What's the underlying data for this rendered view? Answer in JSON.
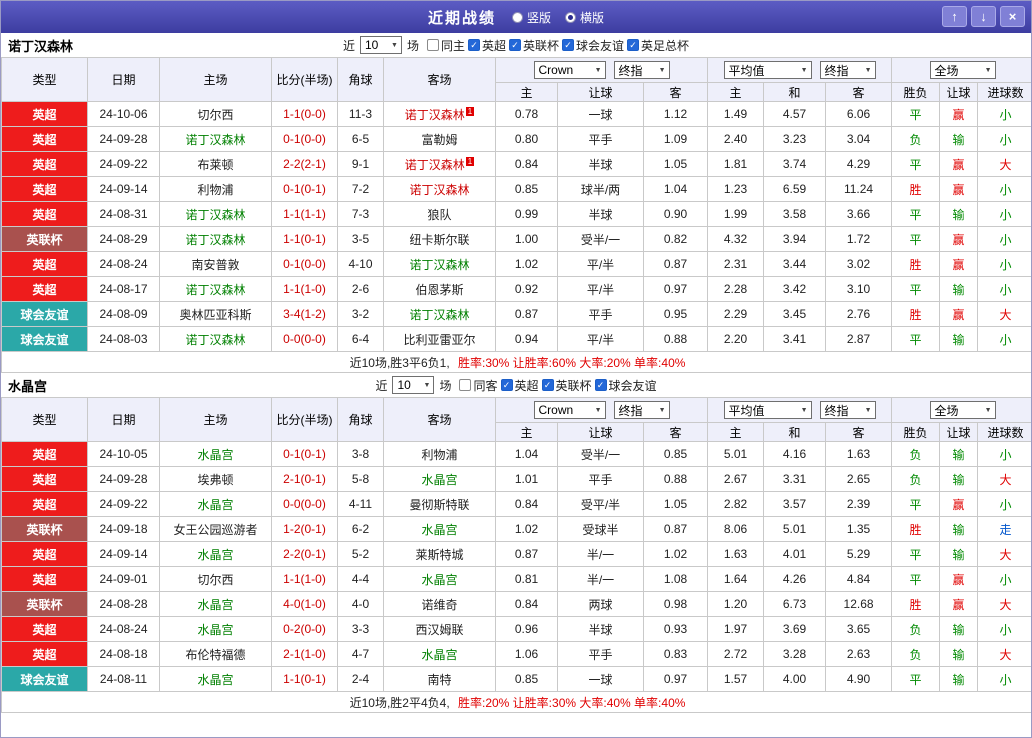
{
  "titlebar": {
    "title": "近期战绩",
    "layout_options": [
      {
        "label": "竖版",
        "selected": false
      },
      {
        "label": "横版",
        "selected": true
      }
    ],
    "buttons": {
      "up": "↑",
      "down": "↓",
      "close": "×"
    }
  },
  "palette": {
    "red": "#e00000",
    "green": "#008a00",
    "blue": "#0055cc",
    "teamGreen": "#008000",
    "teamRed": "#cc0000",
    "black": "#222222",
    "score": "#cc0000",
    "eplBg": "#ee1c1c",
    "eflBg": "#a9514e",
    "friendlyBg": "#2ba8a8"
  },
  "sections": [
    {
      "team": "诺丁汉森林",
      "filter": {
        "prefix": "近",
        "count": "10",
        "suffix": "场",
        "checkboxes": [
          {
            "label": "同主",
            "checked": false
          },
          {
            "label": "英超",
            "checked": true
          },
          {
            "label": "英联杯",
            "checked": true
          },
          {
            "label": "球会友谊",
            "checked": true
          },
          {
            "label": "英足总杯",
            "checked": true
          }
        ]
      },
      "header": {
        "type": "类型",
        "date": "日期",
        "home": "主场",
        "score": "比分(半场)",
        "corners": "角球",
        "away": "客场",
        "ah_group": {
          "bookmaker": "Crown",
          "final": "终指",
          "cols": [
            "主",
            "让球",
            "客"
          ]
        },
        "avg_group": {
          "avg": "平均值",
          "final": "终指",
          "cols": [
            "主",
            "和",
            "客"
          ]
        },
        "ft_group": {
          "fulltime": "全场",
          "cols": [
            "胜负",
            "让球",
            "进球数"
          ]
        }
      },
      "rows": [
        {
          "type": "英超",
          "type_bg": "eplBg",
          "date": "24-10-06",
          "home": "切尔西",
          "home_color": "black",
          "home_badge": "",
          "score": "1-1(0-0)",
          "corners": "11-3",
          "away": "诺丁汉森林",
          "away_color": "teamRed",
          "away_badge": "1",
          "ah_home": "0.78",
          "ah_line": "一球",
          "ah_away": "1.12",
          "avg_home": "1.49",
          "avg_draw": "4.57",
          "avg_away": "6.06",
          "result": "平",
          "result_color": "green",
          "handicap": "赢",
          "handicap_color": "red",
          "goals": "小",
          "goals_color": "green"
        },
        {
          "type": "英超",
          "type_bg": "eplBg",
          "date": "24-09-28",
          "home": "诺丁汉森林",
          "home_color": "teamGreen",
          "home_badge": "",
          "score": "0-1(0-0)",
          "corners": "6-5",
          "away": "富勒姆",
          "away_color": "black",
          "away_badge": "",
          "ah_home": "0.80",
          "ah_line": "平手",
          "ah_away": "1.09",
          "avg_home": "2.40",
          "avg_draw": "3.23",
          "avg_away": "3.04",
          "result": "负",
          "result_color": "green",
          "handicap": "输",
          "handicap_color": "green",
          "goals": "小",
          "goals_color": "green"
        },
        {
          "type": "英超",
          "type_bg": "eplBg",
          "date": "24-09-22",
          "home": "布莱顿",
          "home_color": "black",
          "home_badge": "",
          "score": "2-2(2-1)",
          "corners": "9-1",
          "away": "诺丁汉森林",
          "away_color": "teamRed",
          "away_badge": "1",
          "ah_home": "0.84",
          "ah_line": "半球",
          "ah_away": "1.05",
          "avg_home": "1.81",
          "avg_draw": "3.74",
          "avg_away": "4.29",
          "result": "平",
          "result_color": "green",
          "handicap": "赢",
          "handicap_color": "red",
          "goals": "大",
          "goals_color": "red"
        },
        {
          "type": "英超",
          "type_bg": "eplBg",
          "date": "24-09-14",
          "home": "利物浦",
          "home_color": "black",
          "home_badge": "",
          "score": "0-1(0-1)",
          "corners": "7-2",
          "away": "诺丁汉森林",
          "away_color": "teamRed",
          "away_badge": "",
          "ah_home": "0.85",
          "ah_line": "球半/两",
          "ah_away": "1.04",
          "avg_home": "1.23",
          "avg_draw": "6.59",
          "avg_away": "11.24",
          "result": "胜",
          "result_color": "red",
          "handicap": "赢",
          "handicap_color": "red",
          "goals": "小",
          "goals_color": "green"
        },
        {
          "type": "英超",
          "type_bg": "eplBg",
          "date": "24-08-31",
          "home": "诺丁汉森林",
          "home_color": "teamGreen",
          "home_badge": "",
          "score": "1-1(1-1)",
          "corners": "7-3",
          "away": "狼队",
          "away_color": "black",
          "away_badge": "",
          "ah_home": "0.99",
          "ah_line": "半球",
          "ah_away": "0.90",
          "avg_home": "1.99",
          "avg_draw": "3.58",
          "avg_away": "3.66",
          "result": "平",
          "result_color": "green",
          "handicap": "输",
          "handicap_color": "green",
          "goals": "小",
          "goals_color": "green"
        },
        {
          "type": "英联杯",
          "type_bg": "eflBg",
          "date": "24-08-29",
          "home": "诺丁汉森林",
          "home_color": "teamGreen",
          "home_badge": "",
          "score": "1-1(0-1)",
          "corners": "3-5",
          "away": "纽卡斯尔联",
          "away_color": "black",
          "away_badge": "",
          "ah_home": "1.00",
          "ah_line": "受半/一",
          "ah_away": "0.82",
          "avg_home": "4.32",
          "avg_draw": "3.94",
          "avg_away": "1.72",
          "result": "平",
          "result_color": "green",
          "handicap": "赢",
          "handicap_color": "red",
          "goals": "小",
          "goals_color": "green"
        },
        {
          "type": "英超",
          "type_bg": "eplBg",
          "date": "24-08-24",
          "home": "南安普敦",
          "home_color": "black",
          "home_badge": "",
          "score": "0-1(0-0)",
          "corners": "4-10",
          "away": "诺丁汉森林",
          "away_color": "teamGreen",
          "away_badge": "",
          "ah_home": "1.02",
          "ah_line": "平/半",
          "ah_away": "0.87",
          "avg_home": "2.31",
          "avg_draw": "3.44",
          "avg_away": "3.02",
          "result": "胜",
          "result_color": "red",
          "handicap": "赢",
          "handicap_color": "red",
          "goals": "小",
          "goals_color": "green"
        },
        {
          "type": "英超",
          "type_bg": "eplBg",
          "date": "24-08-17",
          "home": "诺丁汉森林",
          "home_color": "teamGreen",
          "home_badge": "",
          "score": "1-1(1-0)",
          "corners": "2-6",
          "away": "伯恩茅斯",
          "away_color": "black",
          "away_badge": "",
          "ah_home": "0.92",
          "ah_line": "平/半",
          "ah_away": "0.97",
          "avg_home": "2.28",
          "avg_draw": "3.42",
          "avg_away": "3.10",
          "result": "平",
          "result_color": "green",
          "handicap": "输",
          "handicap_color": "green",
          "goals": "小",
          "goals_color": "green"
        },
        {
          "type": "球会友谊",
          "type_bg": "friendlyBg",
          "date": "24-08-09",
          "home": "奥林匹亚科斯",
          "home_color": "black",
          "home_badge": "",
          "score": "3-4(1-2)",
          "corners": "3-2",
          "away": "诺丁汉森林",
          "away_color": "teamGreen",
          "away_badge": "",
          "ah_home": "0.87",
          "ah_line": "平手",
          "ah_away": "0.95",
          "avg_home": "2.29",
          "avg_draw": "3.45",
          "avg_away": "2.76",
          "result": "胜",
          "result_color": "red",
          "handicap": "赢",
          "handicap_color": "red",
          "goals": "大",
          "goals_color": "red"
        },
        {
          "type": "球会友谊",
          "type_bg": "friendlyBg",
          "date": "24-08-03",
          "home": "诺丁汉森林",
          "home_color": "teamGreen",
          "home_badge": "",
          "score": "0-0(0-0)",
          "corners": "6-4",
          "away": "比利亚雷亚尔",
          "away_color": "black",
          "away_badge": "",
          "ah_home": "0.94",
          "ah_line": "平/半",
          "ah_away": "0.88",
          "avg_home": "2.20",
          "avg_draw": "3.41",
          "avg_away": "2.87",
          "result": "平",
          "result_color": "green",
          "handicap": "输",
          "handicap_color": "green",
          "goals": "小",
          "goals_color": "green"
        }
      ],
      "summary": {
        "record": "近10场,胜3平6负1,",
        "rates": "胜率:30% 让胜率:60% 大率:20% 单率:40%"
      }
    },
    {
      "team": "水晶宫",
      "filter": {
        "prefix": "近",
        "count": "10",
        "suffix": "场",
        "checkboxes": [
          {
            "label": "同客",
            "checked": false
          },
          {
            "label": "英超",
            "checked": true
          },
          {
            "label": "英联杯",
            "checked": true
          },
          {
            "label": "球会友谊",
            "checked": true
          }
        ]
      },
      "header": {
        "type": "类型",
        "date": "日期",
        "home": "主场",
        "score": "比分(半场)",
        "corners": "角球",
        "away": "客场",
        "ah_group": {
          "bookmaker": "Crown",
          "final": "终指",
          "cols": [
            "主",
            "让球",
            "客"
          ]
        },
        "avg_group": {
          "avg": "平均值",
          "final": "终指",
          "cols": [
            "主",
            "和",
            "客"
          ]
        },
        "ft_group": {
          "fulltime": "全场",
          "cols": [
            "胜负",
            "让球",
            "进球数"
          ]
        }
      },
      "rows": [
        {
          "type": "英超",
          "type_bg": "eplBg",
          "date": "24-10-05",
          "home": "水晶宫",
          "home_color": "teamGreen",
          "home_badge": "",
          "score": "0-1(0-1)",
          "corners": "3-8",
          "away": "利物浦",
          "away_color": "black",
          "away_badge": "",
          "ah_home": "1.04",
          "ah_line": "受半/一",
          "ah_away": "0.85",
          "avg_home": "5.01",
          "avg_draw": "4.16",
          "avg_away": "1.63",
          "result": "负",
          "result_color": "green",
          "handicap": "输",
          "handicap_color": "green",
          "goals": "小",
          "goals_color": "green"
        },
        {
          "type": "英超",
          "type_bg": "eplBg",
          "date": "24-09-28",
          "home": "埃弗顿",
          "home_color": "black",
          "home_badge": "",
          "score": "2-1(0-1)",
          "corners": "5-8",
          "away": "水晶宫",
          "away_color": "teamGreen",
          "away_badge": "",
          "ah_home": "1.01",
          "ah_line": "平手",
          "ah_away": "0.88",
          "avg_home": "2.67",
          "avg_draw": "3.31",
          "avg_away": "2.65",
          "result": "负",
          "result_color": "green",
          "handicap": "输",
          "handicap_color": "green",
          "goals": "大",
          "goals_color": "red"
        },
        {
          "type": "英超",
          "type_bg": "eplBg",
          "date": "24-09-22",
          "home": "水晶宫",
          "home_color": "teamGreen",
          "home_badge": "",
          "score": "0-0(0-0)",
          "corners": "4-11",
          "away": "曼彻斯特联",
          "away_color": "black",
          "away_badge": "",
          "ah_home": "0.84",
          "ah_line": "受平/半",
          "ah_away": "1.05",
          "avg_home": "2.82",
          "avg_draw": "3.57",
          "avg_away": "2.39",
          "result": "平",
          "result_color": "green",
          "handicap": "赢",
          "handicap_color": "red",
          "goals": "小",
          "goals_color": "green"
        },
        {
          "type": "英联杯",
          "type_bg": "eflBg",
          "date": "24-09-18",
          "home": "女王公园巡游者",
          "home_color": "black",
          "home_badge": "",
          "score": "1-2(0-1)",
          "corners": "6-2",
          "away": "水晶宫",
          "away_color": "teamGreen",
          "away_badge": "",
          "ah_home": "1.02",
          "ah_line": "受球半",
          "ah_away": "0.87",
          "avg_home": "8.06",
          "avg_draw": "5.01",
          "avg_away": "1.35",
          "result": "胜",
          "result_color": "red",
          "handicap": "输",
          "handicap_color": "green",
          "goals": "走",
          "goals_color": "blue"
        },
        {
          "type": "英超",
          "type_bg": "eplBg",
          "date": "24-09-14",
          "home": "水晶宫",
          "home_color": "teamGreen",
          "home_badge": "",
          "score": "2-2(0-1)",
          "corners": "5-2",
          "away": "莱斯特城",
          "away_color": "black",
          "away_badge": "",
          "ah_home": "0.87",
          "ah_line": "半/一",
          "ah_away": "1.02",
          "avg_home": "1.63",
          "avg_draw": "4.01",
          "avg_away": "5.29",
          "result": "平",
          "result_color": "green",
          "handicap": "输",
          "handicap_color": "green",
          "goals": "大",
          "goals_color": "red"
        },
        {
          "type": "英超",
          "type_bg": "eplBg",
          "date": "24-09-01",
          "home": "切尔西",
          "home_color": "black",
          "home_badge": "",
          "score": "1-1(1-0)",
          "corners": "4-4",
          "away": "水晶宫",
          "away_color": "teamGreen",
          "away_badge": "",
          "ah_home": "0.81",
          "ah_line": "半/一",
          "ah_away": "1.08",
          "avg_home": "1.64",
          "avg_draw": "4.26",
          "avg_away": "4.84",
          "result": "平",
          "result_color": "green",
          "handicap": "赢",
          "handicap_color": "red",
          "goals": "小",
          "goals_color": "green"
        },
        {
          "type": "英联杯",
          "type_bg": "eflBg",
          "date": "24-08-28",
          "home": "水晶宫",
          "home_color": "teamGreen",
          "home_badge": "",
          "score": "4-0(1-0)",
          "corners": "4-0",
          "away": "诺维奇",
          "away_color": "black",
          "away_badge": "",
          "ah_home": "0.84",
          "ah_line": "两球",
          "ah_away": "0.98",
          "avg_home": "1.20",
          "avg_draw": "6.73",
          "avg_away": "12.68",
          "result": "胜",
          "result_color": "red",
          "handicap": "赢",
          "handicap_color": "red",
          "goals": "大",
          "goals_color": "red"
        },
        {
          "type": "英超",
          "type_bg": "eplBg",
          "date": "24-08-24",
          "home": "水晶宫",
          "home_color": "teamGreen",
          "home_badge": "",
          "score": "0-2(0-0)",
          "corners": "3-3",
          "away": "西汉姆联",
          "away_color": "black",
          "away_badge": "",
          "ah_home": "0.96",
          "ah_line": "半球",
          "ah_away": "0.93",
          "avg_home": "1.97",
          "avg_draw": "3.69",
          "avg_away": "3.65",
          "result": "负",
          "result_color": "green",
          "handicap": "输",
          "handicap_color": "green",
          "goals": "小",
          "goals_color": "green"
        },
        {
          "type": "英超",
          "type_bg": "eplBg",
          "date": "24-08-18",
          "home": "布伦特福德",
          "home_color": "black",
          "home_badge": "",
          "score": "2-1(1-0)",
          "corners": "4-7",
          "away": "水晶宫",
          "away_color": "teamGreen",
          "away_badge": "",
          "ah_home": "1.06",
          "ah_line": "平手",
          "ah_away": "0.83",
          "avg_home": "2.72",
          "avg_draw": "3.28",
          "avg_away": "2.63",
          "result": "负",
          "result_color": "green",
          "handicap": "输",
          "handicap_color": "green",
          "goals": "大",
          "goals_color": "red"
        },
        {
          "type": "球会友谊",
          "type_bg": "friendlyBg",
          "date": "24-08-11",
          "home": "水晶宫",
          "home_color": "teamGreen",
          "home_badge": "",
          "score": "1-1(0-1)",
          "corners": "2-4",
          "away": "南特",
          "away_color": "black",
          "away_badge": "",
          "ah_home": "0.85",
          "ah_line": "一球",
          "ah_away": "0.97",
          "avg_home": "1.57",
          "avg_draw": "4.00",
          "avg_away": "4.90",
          "result": "平",
          "result_color": "green",
          "handicap": "输",
          "handicap_color": "green",
          "goals": "小",
          "goals_color": "green"
        }
      ],
      "summary": {
        "record": "近10场,胜2平4负4,",
        "rates": "胜率:20% 让胜率:30% 大率:40% 单率:40%"
      }
    }
  ]
}
